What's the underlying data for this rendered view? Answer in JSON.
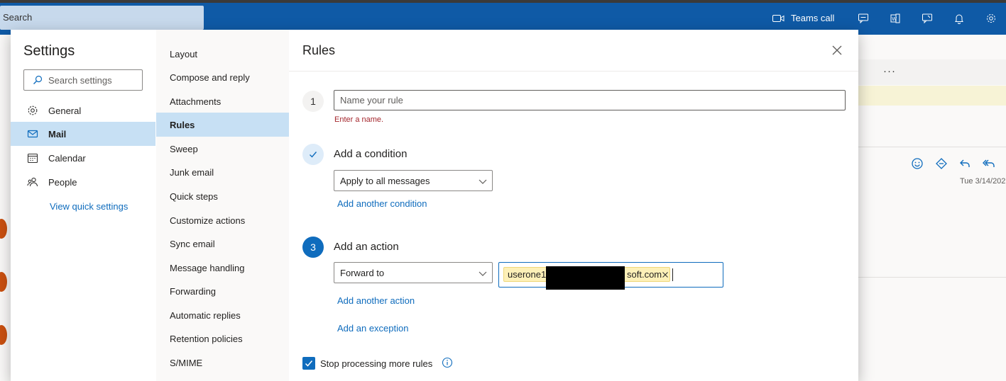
{
  "app": {
    "search_label": "Search",
    "teams_call_label": "Teams call",
    "reading_date": "Tue 3/14/202",
    "more_label": "···"
  },
  "settings": {
    "title": "Settings",
    "search_placeholder": "Search settings",
    "nav": [
      {
        "label": "General",
        "icon": "gear-icon"
      },
      {
        "label": "Mail",
        "icon": "mail-icon",
        "selected": true
      },
      {
        "label": "Calendar",
        "icon": "calendar-icon"
      },
      {
        "label": "People",
        "icon": "people-icon"
      }
    ],
    "quick_settings_link": "View quick settings",
    "mail_nav": [
      {
        "label": "Layout"
      },
      {
        "label": "Compose and reply"
      },
      {
        "label": "Attachments"
      },
      {
        "label": "Rules",
        "selected": true
      },
      {
        "label": "Sweep"
      },
      {
        "label": "Junk email"
      },
      {
        "label": "Quick steps"
      },
      {
        "label": "Customize actions"
      },
      {
        "label": "Sync email"
      },
      {
        "label": "Message handling"
      },
      {
        "label": "Forwarding"
      },
      {
        "label": "Automatic replies"
      },
      {
        "label": "Retention policies"
      },
      {
        "label": "S/MIME"
      }
    ]
  },
  "rules": {
    "title": "Rules",
    "step1": {
      "number": "1",
      "name_placeholder": "Name your rule",
      "name_value": "",
      "error": "Enter a name."
    },
    "condition": {
      "title": "Add a condition",
      "selected": "Apply to all messages",
      "add_link": "Add another condition"
    },
    "action": {
      "number": "3",
      "title": "Add an action",
      "selected": "Forward to",
      "recipient_start": "userone1",
      "recipient_end": "soft.com",
      "add_link": "Add another action"
    },
    "exception_link": "Add an exception",
    "stop_processing": {
      "label": "Stop processing more rules",
      "checked": true
    }
  },
  "colors": {
    "accent": "#0f6cbd",
    "app_bar": "#0f5aa6",
    "selected_nav": "#c7e0f4",
    "error": "#a4262c"
  }
}
